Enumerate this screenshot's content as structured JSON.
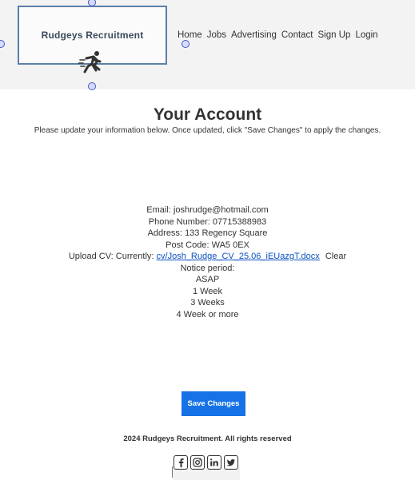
{
  "brand": {
    "name": "Rudgeys Recruitment",
    "runner_icon": "running-man-icon"
  },
  "nav": [
    "Home",
    "Jobs",
    "Advertising",
    "Contact",
    "Sign Up",
    "Login"
  ],
  "page": {
    "title": "Your Account",
    "subtitle": "Please update your information below. Once updated, click \"Save Changes\" to apply the changes."
  },
  "account": {
    "email_label": "Email:",
    "email": "joshrudge@hotmail.com",
    "phone_label": "Phone Number:",
    "phone": "07715388983",
    "address_label": "Address:",
    "address": "133 Regency Square",
    "postcode_label": "Post Code:",
    "postcode": "WA5 0EX",
    "cv_label": "Upload CV: Currently:",
    "cv_link": "cv/Josh_Rudge_CV_25.06_iEUazgT.docx",
    "cv_clear": "Clear",
    "notice_label": "Notice period:",
    "notice_options": [
      "ASAP",
      "1 Week",
      "3 Weeks",
      "4 Week or more"
    ]
  },
  "actions": {
    "save_label": "Save Changes"
  },
  "footer": {
    "copyright": "2024 Rudgeys Recruitment. All rights reserved",
    "social": [
      "facebook-icon",
      "instagram-icon",
      "linkedin-icon",
      "twitter-icon"
    ]
  },
  "colors": {
    "accent": "#1672e6",
    "link": "#0b50c2",
    "logo_border": "#5b7fa6"
  }
}
